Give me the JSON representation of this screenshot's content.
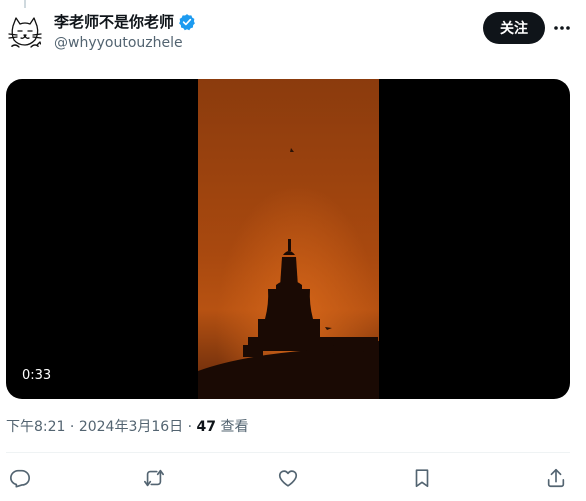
{
  "author": {
    "display_name": "李老师不是你老师",
    "handle": "@whyyoutouzhele",
    "verified": true,
    "avatar_icon": "cat-doodle-avatar"
  },
  "header": {
    "follow_label": "关注",
    "more_icon": "more-dots-icon"
  },
  "media": {
    "type": "video",
    "duration": "0:33"
  },
  "meta": {
    "time": "下午8:21",
    "separator": "·",
    "date": "2024年3月16日",
    "views_count": "47",
    "views_label": "查看"
  },
  "actions": [
    {
      "icon": "reply-icon"
    },
    {
      "icon": "retweet-icon"
    },
    {
      "icon": "like-icon"
    },
    {
      "icon": "bookmark-icon"
    },
    {
      "icon": "share-icon"
    }
  ],
  "colors": {
    "text": "#0f1419",
    "secondary": "#536471",
    "verified_blue": "#1d9bf0",
    "video_sky": "#a9490f"
  }
}
